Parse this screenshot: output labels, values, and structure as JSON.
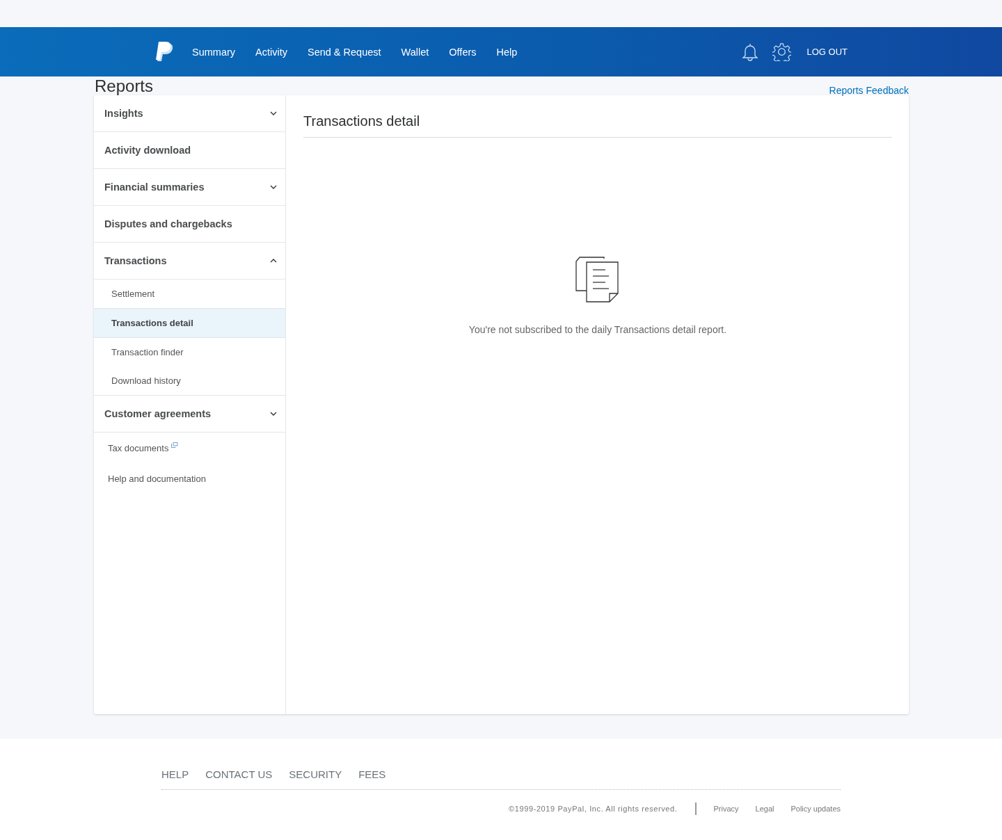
{
  "nav": {
    "items": [
      {
        "label": "Summary"
      },
      {
        "label": "Activity"
      },
      {
        "label": "Send & Request"
      },
      {
        "label": "Wallet"
      },
      {
        "label": "Offers"
      },
      {
        "label": "Help"
      }
    ],
    "logout": "LOG OUT"
  },
  "page": {
    "title": "Reports",
    "feedback_link": "Reports Feedback"
  },
  "sidebar": {
    "items": [
      {
        "kind": "group",
        "label": "Insights",
        "expanded": false
      },
      {
        "kind": "group",
        "label": "Activity download"
      },
      {
        "kind": "group",
        "label": "Financial summaries",
        "expanded": false
      },
      {
        "kind": "group",
        "label": "Disputes and chargebacks"
      },
      {
        "kind": "group",
        "label": "Transactions",
        "expanded": true,
        "children": [
          {
            "label": "Settlement",
            "selected": false
          },
          {
            "label": "Transactions detail",
            "selected": true
          },
          {
            "label": "Transaction finder",
            "selected": false
          },
          {
            "label": "Download history",
            "selected": false
          }
        ]
      },
      {
        "kind": "group",
        "label": "Customer agreements",
        "expanded": false
      },
      {
        "kind": "link",
        "label": "Tax documents",
        "external": true
      },
      {
        "kind": "link",
        "label": "Help and documentation",
        "external": false
      }
    ]
  },
  "content": {
    "title": "Transactions detail",
    "empty_message": "You're not subscribed to the daily Transactions detail report."
  },
  "footer": {
    "links": [
      "HELP",
      "CONTACT US",
      "SECURITY",
      "FEES"
    ],
    "copyright": "©1999-2019 PayPal, Inc. All rights reserved.",
    "legal_links": [
      "Privacy",
      "Legal",
      "Policy updates"
    ]
  }
}
